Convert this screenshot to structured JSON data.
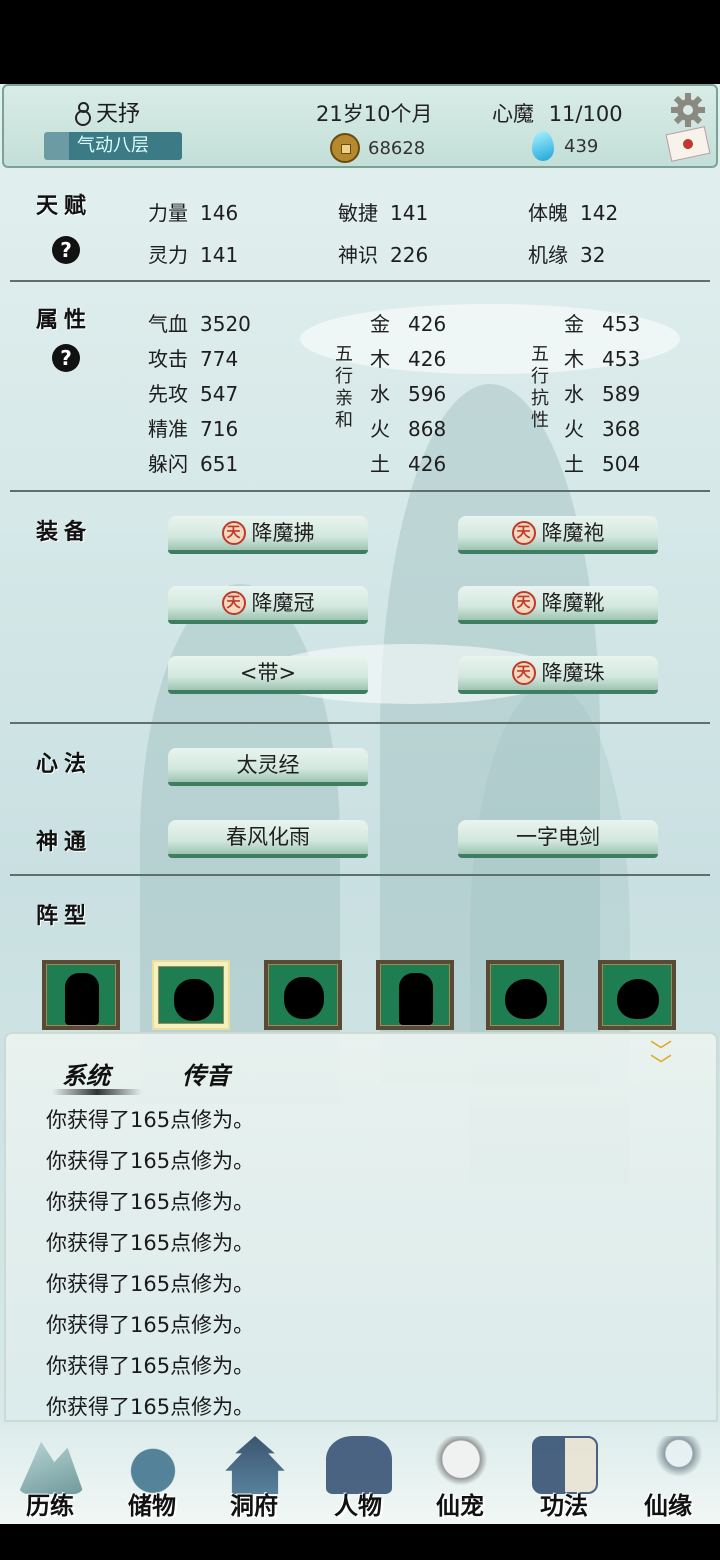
{
  "header": {
    "name": "天抒",
    "realm": "气动八层",
    "realm_progress": 0.18,
    "age": "21岁10个月",
    "xinmo_label": "心魔",
    "xinmo_value": "11/100",
    "coins": "68628",
    "gems": "439",
    "icons": [
      "gourd-icon",
      "gear-icon",
      "coin-icon",
      "gem-icon",
      "mail-icon"
    ]
  },
  "talent": {
    "label": "天赋",
    "help": "?",
    "stats": [
      {
        "name": "力量",
        "value": "146"
      },
      {
        "name": "敏捷",
        "value": "141"
      },
      {
        "name": "体魄",
        "value": "142"
      },
      {
        "name": "灵力",
        "value": "141"
      },
      {
        "name": "神识",
        "value": "226"
      },
      {
        "name": "机缘",
        "value": "32"
      }
    ]
  },
  "attributes": {
    "label": "属性",
    "help": "?",
    "basic": [
      {
        "name": "气血",
        "value": "3520"
      },
      {
        "name": "攻击",
        "value": "774"
      },
      {
        "name": "先攻",
        "value": "547"
      },
      {
        "name": "精准",
        "value": "716"
      },
      {
        "name": "躲闪",
        "value": "651"
      }
    ],
    "affinity_title": [
      "五",
      "行",
      "亲",
      "和"
    ],
    "affinity": [
      {
        "name": "金",
        "value": "426"
      },
      {
        "name": "木",
        "value": "426"
      },
      {
        "name": "水",
        "value": "596"
      },
      {
        "name": "火",
        "value": "868"
      },
      {
        "name": "土",
        "value": "426"
      }
    ],
    "resist_title": [
      "五",
      "行",
      "抗",
      "性"
    ],
    "resist": [
      {
        "name": "金",
        "value": "453"
      },
      {
        "name": "木",
        "value": "453"
      },
      {
        "name": "水",
        "value": "589"
      },
      {
        "name": "火",
        "value": "368"
      },
      {
        "name": "土",
        "value": "504"
      }
    ]
  },
  "equipment": {
    "label": "装备",
    "icon_glyph": "天",
    "items": [
      {
        "label": "降魔拂",
        "has_icon": true
      },
      {
        "label": "降魔袍",
        "has_icon": true
      },
      {
        "label": "降魔冠",
        "has_icon": true
      },
      {
        "label": "降魔靴",
        "has_icon": true
      },
      {
        "label": "<带>",
        "has_icon": false
      },
      {
        "label": "降魔珠",
        "has_icon": true
      }
    ]
  },
  "xinfa": {
    "label": "心法",
    "items": [
      "太灵经"
    ]
  },
  "shentong": {
    "label": "神通",
    "items": [
      "春风化雨",
      "一字电剑"
    ]
  },
  "formation": {
    "label": "阵型",
    "slots": [
      {
        "figure": "robed-cultivator",
        "selected": false
      },
      {
        "figure": "horned-beast",
        "selected": true
      },
      {
        "figure": "horned-beast",
        "selected": false
      },
      {
        "figure": "robed-cultivator",
        "selected": false
      },
      {
        "figure": "ghost-spirit",
        "selected": false
      },
      {
        "figure": "ghost-spirit",
        "selected": false
      }
    ]
  },
  "chat": {
    "tabs": [
      "系统",
      "传音"
    ],
    "collapse_icon": "double-chevron-down-icon",
    "messages": [
      "你获得了165点修为。",
      "你获得了165点修为。",
      "你获得了165点修为。",
      "你获得了165点修为。",
      "你获得了165点修为。",
      "你获得了165点修为。",
      "你获得了165点修为。",
      "你获得了165点修为。"
    ]
  },
  "nav": [
    {
      "label": "历练",
      "icon": "mountain-icon"
    },
    {
      "label": "储物",
      "icon": "bag-icon"
    },
    {
      "label": "洞府",
      "icon": "pagoda-icon"
    },
    {
      "label": "人物",
      "icon": "character-icon"
    },
    {
      "label": "仙宠",
      "icon": "pet-icon"
    },
    {
      "label": "功法",
      "icon": "book-icon"
    },
    {
      "label": "仙缘",
      "icon": "crane-icon"
    }
  ]
}
